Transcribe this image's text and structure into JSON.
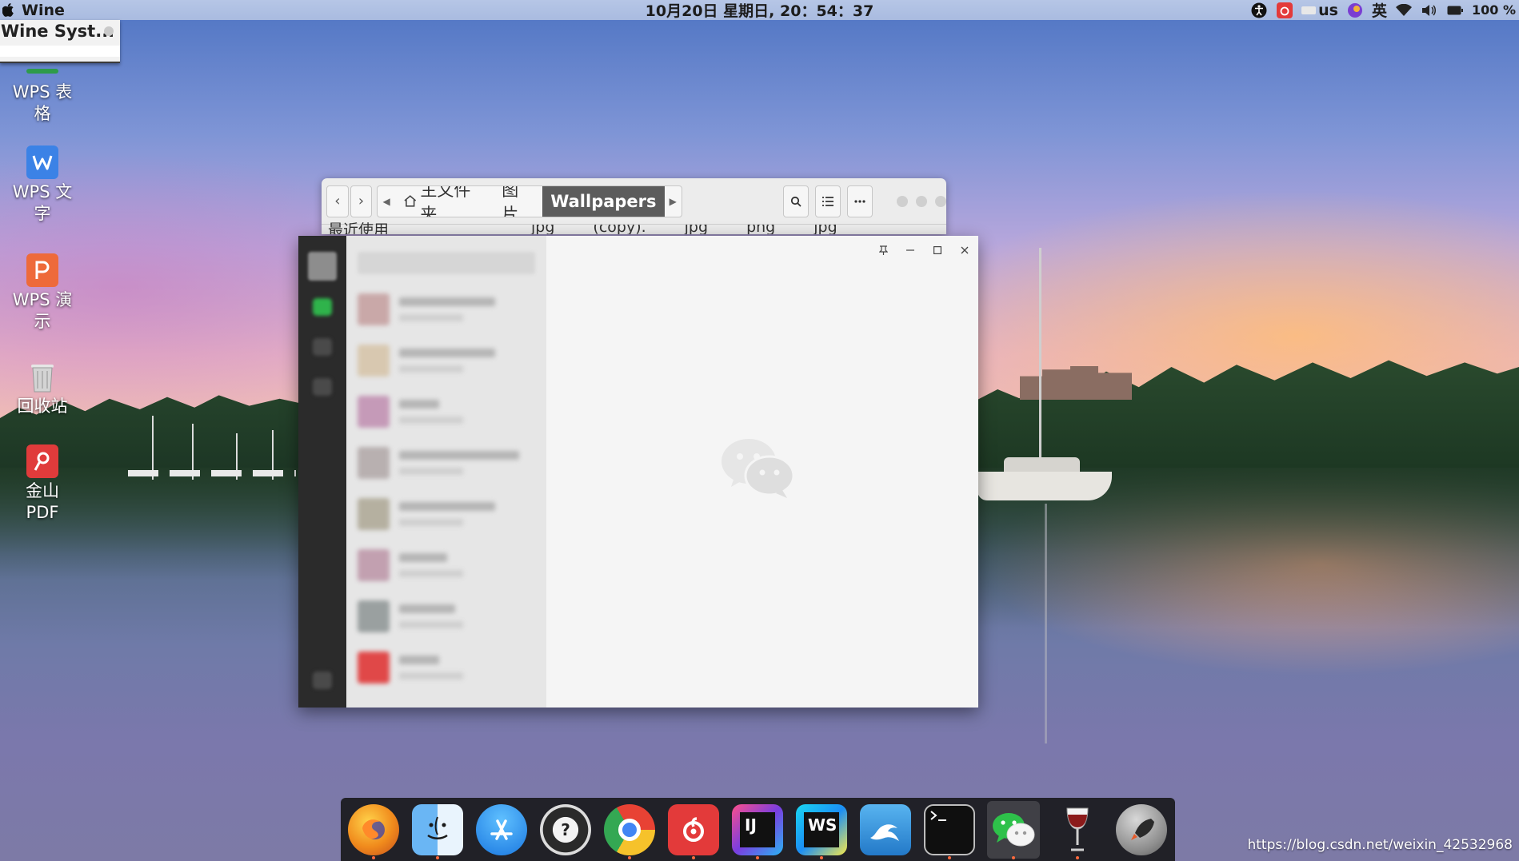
{
  "topbar": {
    "app_name": "Wine",
    "clock": "10月20日 星期日, 20：54：37",
    "keyboard_layout": "us",
    "input_method": "英",
    "battery": "100 %"
  },
  "wine_systray": {
    "title": "Wine Syst..."
  },
  "desktop_icons": [
    {
      "label": "WPS 表\n格",
      "icon": "wps-spreadsheet-icon",
      "color": "#2e9b4a"
    },
    {
      "label": "WPS 文\n字",
      "icon": "wps-writer-icon",
      "color": "#3b82e6"
    },
    {
      "label": "WPS 演\n示",
      "icon": "wps-presentation-icon",
      "color": "#ee6a3a"
    },
    {
      "label": "回收站",
      "icon": "trash-icon"
    },
    {
      "label": "金山\nPDF",
      "icon": "kingsoft-pdf-icon",
      "color": "#e03b3b"
    }
  ],
  "file_manager": {
    "breadcrumbs": [
      "主文件夹",
      "图片",
      "Wallpapers"
    ],
    "files_peek": [
      "jpg",
      "(copy).",
      "jpg",
      "png",
      "jpg"
    ],
    "sidebar_peek": "最近使用"
  },
  "wechat": {
    "controls": [
      "pin",
      "minimize",
      "maximize",
      "close"
    ]
  },
  "dock": {
    "apps": [
      {
        "name": "firefox-icon",
        "color": "#f08a1c",
        "running": true
      },
      {
        "name": "finder-icon",
        "color": "#3e9df0",
        "running": true
      },
      {
        "name": "app-store-icon",
        "color": "#1b8ef5",
        "running": false
      },
      {
        "name": "help-lifebuoy-icon",
        "color": "#3a3a3a",
        "running": false
      },
      {
        "name": "chrome-icon",
        "color": "#e9e9e9",
        "running": true
      },
      {
        "name": "netease-music-icon",
        "color": "#e33a3a",
        "running": true
      },
      {
        "name": "intellij-idea-icon",
        "color": "#1e1e3a",
        "running": true
      },
      {
        "name": "webstorm-icon",
        "color": "#1da1f2",
        "running": true
      },
      {
        "name": "mysql-workbench-icon",
        "color": "#2f8fd8",
        "running": false
      },
      {
        "name": "terminal-icon",
        "color": "#111111",
        "running": true
      },
      {
        "name": "wechat-icon",
        "color": "#ffffff",
        "running": true
      },
      {
        "name": "wine-glass-icon",
        "color": "#8b1a1a",
        "running": true
      },
      {
        "name": "launchpad-rocket-icon",
        "color": "#9a9a9a",
        "running": false
      }
    ],
    "tile_labels": {
      "intellij": "IJ",
      "webstorm": "WS"
    }
  },
  "watermark": "https://blog.csdn.net/weixin_42532968"
}
